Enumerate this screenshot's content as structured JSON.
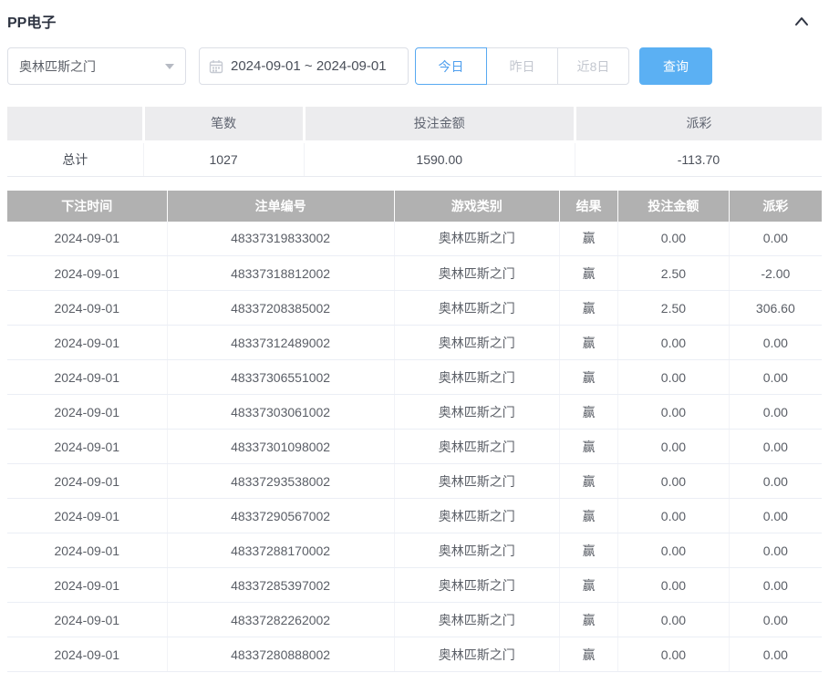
{
  "panel": {
    "title": "PP电子"
  },
  "filters": {
    "game_select": {
      "value": "奥林匹斯之门"
    },
    "date_range": {
      "value": "2024-09-01 ~ 2024-09-01"
    },
    "quick_ranges": [
      {
        "label": "今日",
        "active": true
      },
      {
        "label": "昨日",
        "active": false
      },
      {
        "label": "近8日",
        "active": false
      }
    ],
    "query_label": "查询"
  },
  "summary": {
    "columns": [
      "",
      "笔数",
      "投注金额",
      "派彩"
    ],
    "total": {
      "label": "总计",
      "count": "1027",
      "bet_amount": "1590.00",
      "payout": "-113.70"
    }
  },
  "records": {
    "columns": [
      "下注时间",
      "注单编号",
      "游戏类别",
      "结果",
      "投注金额",
      "派彩"
    ],
    "col_keys": [
      "bet-time",
      "order-id",
      "game-type",
      "result",
      "bet-amount",
      "payout"
    ],
    "rows": [
      [
        "2024-09-01",
        "48337319833002",
        "奥林匹斯之门",
        "赢",
        "0.00",
        "0.00"
      ],
      [
        "2024-09-01",
        "48337318812002",
        "奥林匹斯之门",
        "赢",
        "2.50",
        "-2.00"
      ],
      [
        "2024-09-01",
        "48337208385002",
        "奥林匹斯之门",
        "赢",
        "2.50",
        "306.60"
      ],
      [
        "2024-09-01",
        "48337312489002",
        "奥林匹斯之门",
        "赢",
        "0.00",
        "0.00"
      ],
      [
        "2024-09-01",
        "48337306551002",
        "奥林匹斯之门",
        "赢",
        "0.00",
        "0.00"
      ],
      [
        "2024-09-01",
        "48337303061002",
        "奥林匹斯之门",
        "赢",
        "0.00",
        "0.00"
      ],
      [
        "2024-09-01",
        "48337301098002",
        "奥林匹斯之门",
        "赢",
        "0.00",
        "0.00"
      ],
      [
        "2024-09-01",
        "48337293538002",
        "奥林匹斯之门",
        "赢",
        "0.00",
        "0.00"
      ],
      [
        "2024-09-01",
        "48337290567002",
        "奥林匹斯之门",
        "赢",
        "0.00",
        "0.00"
      ],
      [
        "2024-09-01",
        "48337288170002",
        "奥林匹斯之门",
        "赢",
        "0.00",
        "0.00"
      ],
      [
        "2024-09-01",
        "48337285397002",
        "奥林匹斯之门",
        "赢",
        "0.00",
        "0.00"
      ],
      [
        "2024-09-01",
        "48337282262002",
        "奥林匹斯之门",
        "赢",
        "0.00",
        "0.00"
      ],
      [
        "2024-09-01",
        "48337280888002",
        "奥林匹斯之门",
        "赢",
        "0.00",
        "0.00"
      ]
    ]
  },
  "colors": {
    "accent_blue": "#58a9f1",
    "query_button_blue": "#5bb0f3",
    "negative_red": "#f56c6c",
    "table_header_gray": "#b1b1b1",
    "summary_header_gray": "#ececee"
  }
}
